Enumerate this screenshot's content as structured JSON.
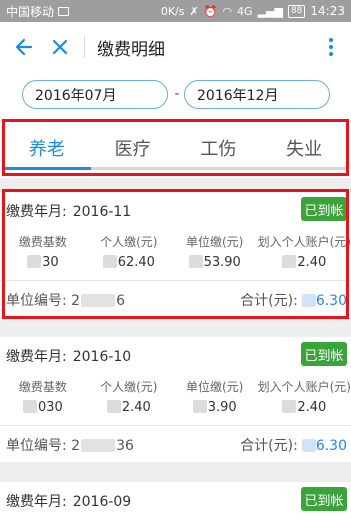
{
  "status_bar": {
    "carrier": "中国移动",
    "speed": "0K/s",
    "network": "4G",
    "battery": "88",
    "time": "14:23"
  },
  "app_bar": {
    "title": "缴费明细"
  },
  "date_range": {
    "from": "2016年07月",
    "separator": "-",
    "to": "2016年12月"
  },
  "tabs": [
    {
      "label": "养老",
      "active": true
    },
    {
      "label": "医疗",
      "active": false
    },
    {
      "label": "工伤",
      "active": false
    },
    {
      "label": "失业",
      "active": false
    }
  ],
  "labels": {
    "month": "缴费年月:",
    "base": "缴费基数",
    "personal": "个人缴(元)",
    "company": "单位缴(元)",
    "account": "划入个人账户(元)",
    "unit_no": "单位编号:",
    "total": "合计(元):"
  },
  "records": [
    {
      "month": "2016-11",
      "status": "已到帐",
      "base": "30",
      "personal": "62.40",
      "company": "53.90",
      "account": "2.40",
      "unit_prefix": "2",
      "unit_suffix": "6",
      "total": "6.30"
    },
    {
      "month": "2016-10",
      "status": "已到帐",
      "base": "030",
      "personal": "2.40",
      "company": "3.90",
      "account": "2.40",
      "unit_prefix": "2",
      "unit_suffix": "36",
      "total": "6.30"
    },
    {
      "month": "2016-09",
      "status": "已到帐"
    }
  ],
  "colors": {
    "accent": "#1e88e5",
    "badge": "#3aa33a",
    "highlight": "#e8141a"
  }
}
